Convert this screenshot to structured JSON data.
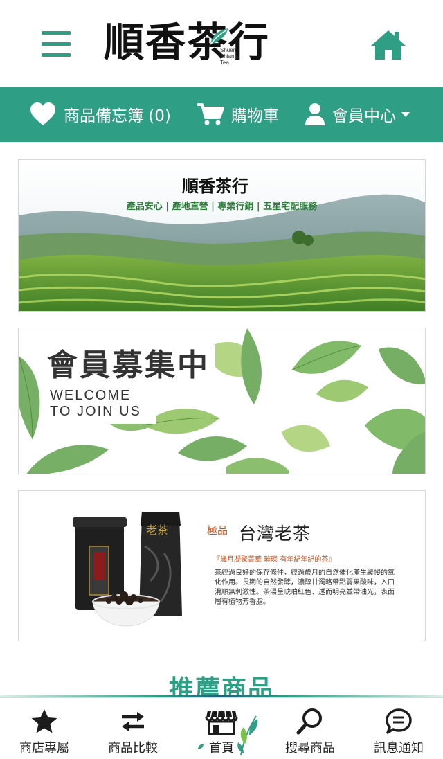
{
  "header": {
    "logo_text": "順香茶行",
    "logo_sub_line1": "Shuen",
    "logo_sub_line2": "Shiang",
    "logo_sub_line3": "Tea"
  },
  "navbar": {
    "wishlist_label": "商品備忘簿 (0)",
    "cart_label": "購物車",
    "member_label": "會員中心"
  },
  "banners": {
    "b1": {
      "logo_text": "順香茶行",
      "slogan": "產品安心 | 產地直營 | 專業行銷 | 五星宅配服務"
    },
    "b2": {
      "title": "會員募集中",
      "sub_line1": "WELCOME",
      "sub_line2": "TO JOIN US"
    },
    "b3": {
      "label": "極品",
      "title": "台灣老茶",
      "quote": "『歲月凝聚菁華 璀璨 有年紀年紀的茶』",
      "can_text": "老茶",
      "description": "茶經過良好的保存條件，經過歲月的自然催化產生緩慢的氧化作用。長期的自然發酵，濃醇甘濁略帶點弱果酸味，入口滑順無刺激性。茶湯呈琥珀紅色、透而明亮並帶油光，表面層有植物芳香脂。"
    }
  },
  "section": {
    "heading": "推薦商品"
  },
  "tabbar": {
    "items": [
      {
        "label": "商店專屬",
        "icon": "star-icon"
      },
      {
        "label": "商品比較",
        "icon": "compare-arrows-icon"
      },
      {
        "label": "首頁",
        "icon": "storefront-icon"
      },
      {
        "label": "搜尋商品",
        "icon": "search-icon"
      },
      {
        "label": "訊息通知",
        "icon": "chat-icon"
      }
    ]
  },
  "colors": {
    "brand_green": "#2e9e85",
    "accent_orange": "#c9531e"
  }
}
